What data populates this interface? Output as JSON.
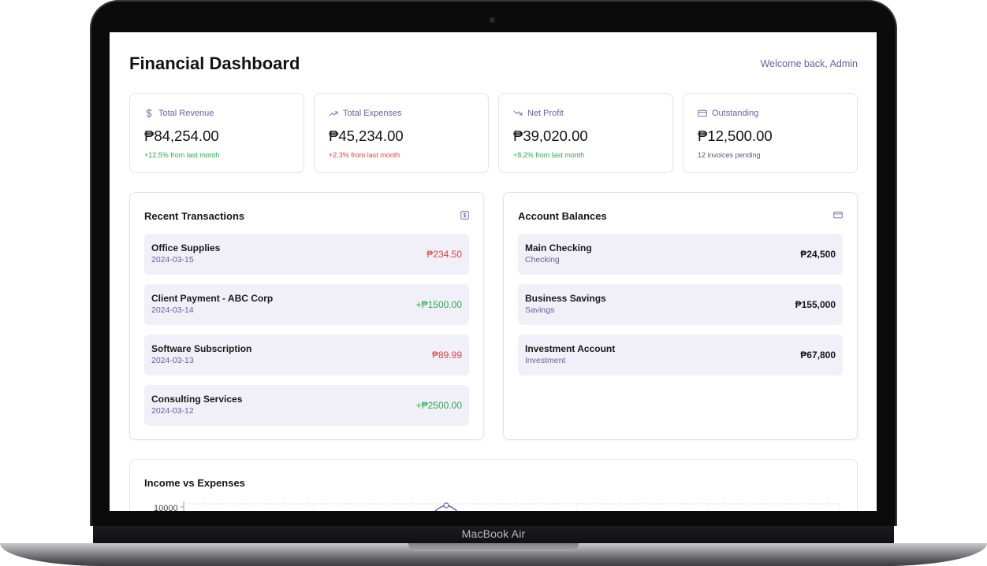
{
  "device": {
    "label": "MacBook Air"
  },
  "header": {
    "title": "Financial Dashboard",
    "welcome": "Welcome back, Admin"
  },
  "stats": [
    {
      "icon": "dollar-icon",
      "label": "Total Revenue",
      "value": "₱84,254.00",
      "note": "+12.5% from last month",
      "trend": "up"
    },
    {
      "icon": "trending-up-icon",
      "label": "Total Expenses",
      "value": "₱45,234.00",
      "note": "+2.3% from last month",
      "trend": "down"
    },
    {
      "icon": "trending-down-icon",
      "label": "Net Profit",
      "value": "₱39,020.00",
      "note": "+8.2% from last month",
      "trend": "up"
    },
    {
      "icon": "credit-card-icon",
      "label": "Outstanding",
      "value": "₱12,500.00",
      "note": "12 invoices pending",
      "trend": "neutral"
    }
  ],
  "transactions": {
    "title": "Recent Transactions",
    "icon": "receipt-icon",
    "items": [
      {
        "name": "Office Supplies",
        "date": "2024-03-15",
        "amount": "₱234.50",
        "kind": "expense"
      },
      {
        "name": "Client Payment - ABC Corp",
        "date": "2024-03-14",
        "amount": "+₱1500.00",
        "kind": "income"
      },
      {
        "name": "Software Subscription",
        "date": "2024-03-13",
        "amount": "₱89.99",
        "kind": "expense"
      },
      {
        "name": "Consulting Services",
        "date": "2024-03-12",
        "amount": "+₱2500.00",
        "kind": "income"
      }
    ]
  },
  "accounts": {
    "title": "Account Balances",
    "icon": "credit-card-icon",
    "items": [
      {
        "name": "Main Checking",
        "type": "Checking",
        "balance": "₱24,500"
      },
      {
        "name": "Business Savings",
        "type": "Savings",
        "balance": "₱155,000"
      },
      {
        "name": "Investment Account",
        "type": "Investment",
        "balance": "₱67,800"
      }
    ]
  },
  "chart": {
    "title": "Income vs Expenses",
    "y_tick_top": "10000"
  },
  "colors": {
    "accent": "#6b60a0",
    "positive": "#2eaa4f",
    "negative": "#e24545",
    "row_bg": "#f1eff8"
  }
}
